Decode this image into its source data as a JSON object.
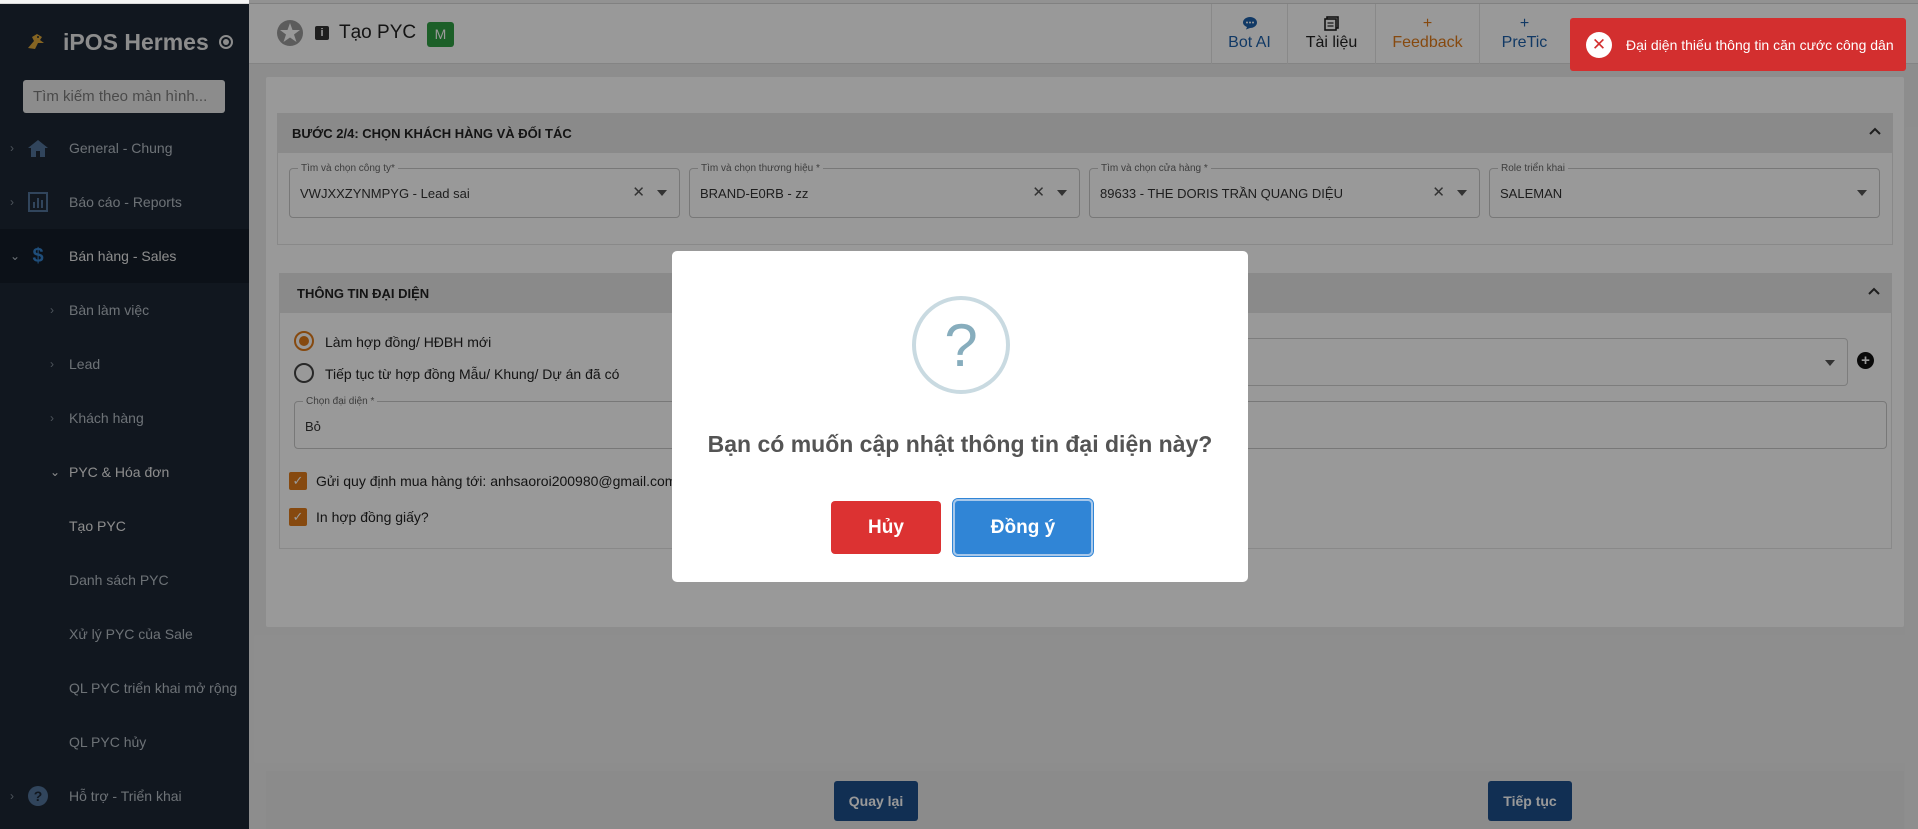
{
  "app": {
    "name": "iPOS Hermes"
  },
  "sidebar": {
    "search_placeholder": "Tìm kiếm theo màn hình...",
    "items": [
      {
        "label": "General - Chung",
        "icon": "home-icon"
      },
      {
        "label": "Báo cáo - Reports",
        "icon": "report-chart-icon"
      },
      {
        "label": "Bán hàng - Sales",
        "icon": "dollar-icon"
      },
      {
        "label": "Bàn làm việc"
      },
      {
        "label": "Lead"
      },
      {
        "label": "Khách hàng"
      },
      {
        "label": "PYC & Hóa đơn"
      },
      {
        "label": "Tạo PYC"
      },
      {
        "label": "Danh sách PYC"
      },
      {
        "label": "Xử lý PYC của Sale"
      },
      {
        "label": "QL PYC triển khai mở rộng"
      },
      {
        "label": "QL PYC hủy"
      },
      {
        "label": "Hỗ trợ - Triển khai",
        "icon": "help-icon"
      }
    ]
  },
  "header": {
    "title": "Tạo PYC",
    "info_badge": "i",
    "badge": "M",
    "tools": [
      {
        "label": "Bot AI",
        "icon": "chat-bubble-icon",
        "color": "#1d5fa8"
      },
      {
        "label": "Tài liệu",
        "icon": "document-icon",
        "color": "#222222"
      },
      {
        "label": "Feedback",
        "icon": "plus-icon",
        "color": "#e07b1a"
      },
      {
        "label": "PreTic",
        "icon": "plus-icon",
        "color": "#1d5fa8"
      }
    ]
  },
  "step_section": {
    "title": "BƯỚC 2/4: CHỌN KHÁCH HÀNG VÀ ĐỐI TÁC",
    "fields": [
      {
        "label": "Tìm và chọn công ty*",
        "value": "VWJXXZYNMPYG - Lead sai"
      },
      {
        "label": "Tìm và chọn thương hiệu *",
        "value": "BRAND-E0RB - zz"
      },
      {
        "label": "Tìm và chọn cửa hàng *",
        "value": "89633 - THE DORIS TRẦN QUANG DIỆU"
      },
      {
        "label": "Role triển khai",
        "value": "SALEMAN"
      }
    ]
  },
  "rep_section": {
    "title": "THÔNG TIN ĐẠI DIỆN",
    "radio_new": "Làm hợp đồng/ HĐBH mới",
    "radio_continue": "Tiếp tục từ hợp đồng Mẫu/ Khung/ Dự án đã có",
    "rep_label": "Chọn đại diện *",
    "rep_value": "Bỏ",
    "check_email": "Gửi quy định mua hàng tới: anhsaoroi200980@gmail.com,",
    "check_print": "In hợp đồng giấy?"
  },
  "footer": {
    "back": "Quay lại",
    "next": "Tiếp tục"
  },
  "dialog": {
    "icon": "?",
    "message": "Bạn có muốn cập nhật thông tin đại diện này?",
    "cancel": "Hủy",
    "confirm": "Đồng ý"
  },
  "toast": {
    "message": "Đại diện thiếu thông tin căn cước công dân"
  },
  "colors": {
    "sidebar_bg": "#1f2b3a",
    "accent_orange": "#e07b1a",
    "primary_blue": "#3085d6",
    "danger_red": "#dc3232",
    "toast_red": "#d32f2f",
    "nav_button": "#1d4f8a"
  }
}
